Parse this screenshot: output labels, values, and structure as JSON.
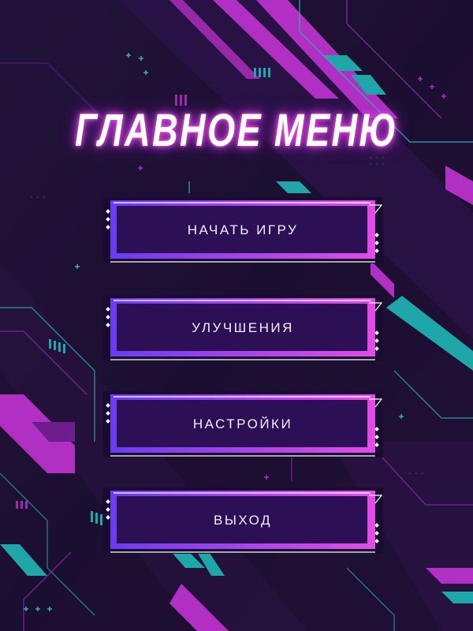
{
  "title": "ГЛАВНОЕ МЕНЮ",
  "buttons": [
    {
      "label": "НАЧАТЬ ИГРУ"
    },
    {
      "label": "УЛУЧШЕНИЯ"
    },
    {
      "label": "НАСТРОЙКИ"
    },
    {
      "label": "ВЫХОД"
    }
  ],
  "colors": {
    "background": "#1c1030",
    "stripe_magenta": "#b12fc2",
    "stripe_teal": "#1ea6a8",
    "button_gradient_start": "#6a3cf0",
    "button_gradient_end": "#e24ce6",
    "button_fill": "#2c0f55",
    "title_glow": "#ff5be0"
  }
}
